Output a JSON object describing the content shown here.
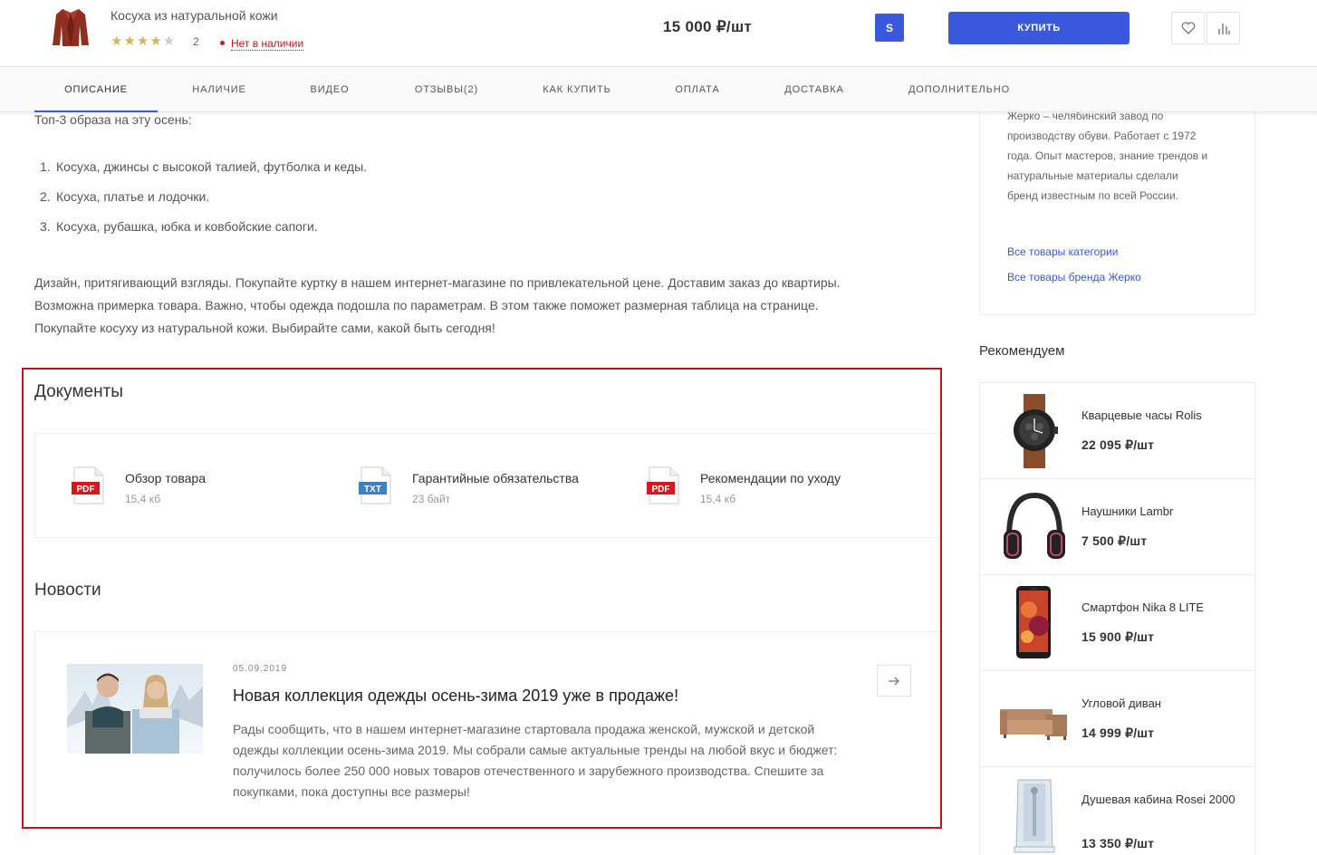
{
  "header": {
    "product_title": "Косуха из натуральной кожи",
    "rating_stars": 4,
    "rating_count": "2",
    "stock_status": "Нет в наличии",
    "price": "15 000 ₽/шт",
    "size": "S",
    "buy_label": "КУПИТЬ",
    "colors": {
      "accent": "#3a58dc",
      "stock": "#d01616",
      "star": "#d4b65a"
    }
  },
  "tabs": [
    {
      "label": "ОПИСАНИЕ",
      "active": true
    },
    {
      "label": "НАЛИЧИЕ"
    },
    {
      "label": "ВИДЕО"
    },
    {
      "label": "ОТЗЫВЫ(2)"
    },
    {
      "label": "КАК КУПИТЬ"
    },
    {
      "label": "ОПЛАТА"
    },
    {
      "label": "ДОСТАВКА"
    },
    {
      "label": "ДОПОЛНИТЕЛЬНО"
    }
  ],
  "description": {
    "intro": "Топ-3 образа на эту осень:",
    "list": [
      {
        "num": "1.",
        "text": "Косуха, джинсы с высокой талией, футболка и кеды."
      },
      {
        "num": "2.",
        "text": "Косуха, платье и лодочки."
      },
      {
        "num": "3.",
        "text": "Косуха, рубашка, юбка и ковбойские сапоги."
      }
    ],
    "lines": [
      "Дизайн, притягивающий взгляды. Покупайте куртку в нашем интернет-магазине по привлекательной цене. Доставим заказ до квартиры.",
      "Возможна примерка товара. Важно, чтобы одежда подошла по параметрам. В этом также поможет размерная таблица на странице.",
      "Покупайте косуху из натуральной кожи. Выбирайте сами, какой быть сегодня!"
    ]
  },
  "documents": {
    "heading": "Документы",
    "items": [
      {
        "name": "Обзор товара",
        "size": "15,4 кб",
        "type": "PDF"
      },
      {
        "name": "Гарантийные обязательства",
        "size": "23 байт",
        "type": "TXT"
      },
      {
        "name": "Рекомендации по уходу",
        "size": "15,4 кб",
        "type": "PDF"
      }
    ]
  },
  "news": {
    "heading": "Новости",
    "date": "05.09.2019",
    "title": "Новая коллекция одежды осень-зима 2019 уже в продаже!",
    "lines": [
      "Рады сообщить, что в нашем интернет-магазине стартовала продажа женской, мужской и детской",
      "одежды коллекции осень-зима 2019. Мы собрали самые актуальные тренды на любой вкус и бюджет:",
      "получилось более 250 000 новых товаров отечественного и зарубежного производства. Спешите за",
      "покупками, пока доступны все размеры!"
    ]
  },
  "brand": {
    "lines": [
      "Жерко – челябинский завод по",
      "производству обуви. Работает с 1972",
      "года. Опыт мастеров, знание трендов и",
      "натуральные материалы сделали",
      "бренд известным по всей России."
    ],
    "link_category": "Все товары категории",
    "link_brand": "Все товары бренда Жерко"
  },
  "recommend": {
    "heading": "Рекомендуем",
    "items": [
      {
        "name": "Кварцевые часы Rolis",
        "price": "22 095 ₽/шт",
        "icon": "watch-icon"
      },
      {
        "name": "Наушники Lambr",
        "price": "7 500 ₽/шт",
        "icon": "headphones-icon"
      },
      {
        "name": "Смартфон Nika 8 LITE",
        "price": "15 900 ₽/шт",
        "icon": "smartphone-icon"
      },
      {
        "name": "Угловой диван",
        "price": "14 999 ₽/шт",
        "icon": "sofa-icon"
      },
      {
        "name": "Душевая кабина Rosei 2000",
        "price": "13 350 ₽/шт",
        "icon": "shower-cabin-icon"
      }
    ]
  }
}
